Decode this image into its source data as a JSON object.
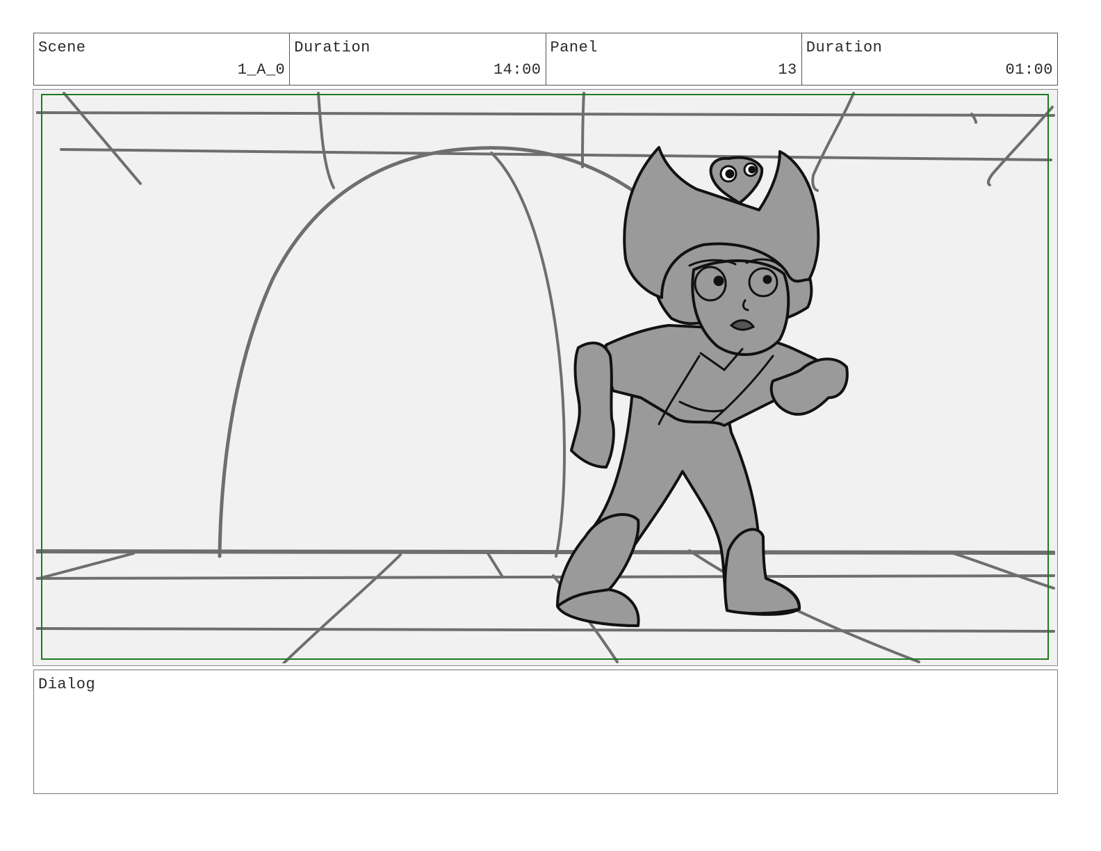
{
  "header": {
    "scene": {
      "label": "Scene",
      "value": "1_A_0"
    },
    "scene_duration": {
      "label": "Duration",
      "value": "14:00"
    },
    "panel": {
      "label": "Panel",
      "value": "13"
    },
    "panel_duration": {
      "label": "Duration",
      "value": "01:00"
    }
  },
  "dialog": {
    "label": "Dialog",
    "text": ""
  },
  "colors": {
    "safe_frame": "#1e7a1e",
    "panel_bg": "#f1f1f1",
    "sketch_line": "#6e6e6e",
    "character_fill": "#9a9a9a",
    "ink": "#111111"
  }
}
